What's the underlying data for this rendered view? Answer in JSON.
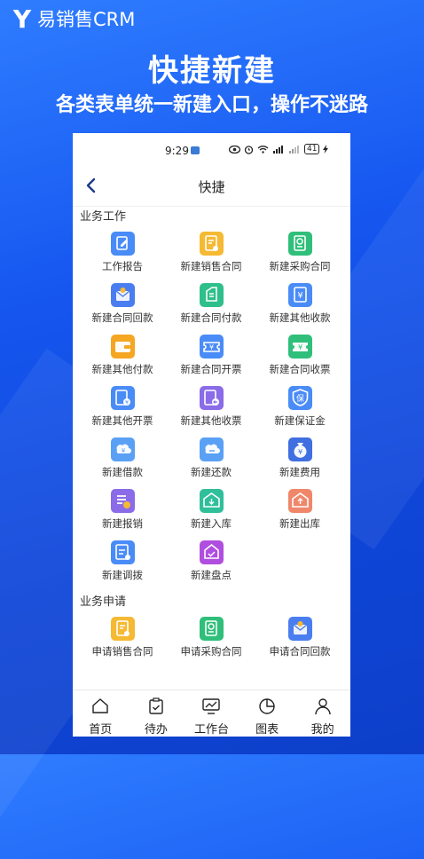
{
  "brand": {
    "logo_letter": "Y",
    "name": "易销售CRM"
  },
  "headline": "快捷新建",
  "subline": "各类表单统一新建入口，操作不迷路",
  "status_bar": {
    "time": "9:29",
    "battery": "41"
  },
  "nav": {
    "title": "快捷"
  },
  "sections": [
    {
      "title": "业务工作",
      "items": [
        {
          "label": "工作报告",
          "icon": "edit-doc-icon",
          "color": "#4a8cf7"
        },
        {
          "label": "新建销售合同",
          "icon": "contract-star-icon",
          "color": "#f5b933"
        },
        {
          "label": "新建采购合同",
          "icon": "contract-award-icon",
          "color": "#2fbf7a"
        },
        {
          "label": "新建合同回款",
          "icon": "envelope-money-icon",
          "color": "#4a7ef0"
        },
        {
          "label": "新建合同付款",
          "icon": "hand-doc-icon",
          "color": "#2fbf8a"
        },
        {
          "label": "新建其他收款",
          "icon": "yen-doc-icon",
          "color": "#4a8cf7"
        },
        {
          "label": "新建其他付款",
          "icon": "wallet-icon",
          "color": "#f5a623"
        },
        {
          "label": "新建合同开票",
          "icon": "ticket-icon",
          "color": "#4a8cf7"
        },
        {
          "label": "新建合同收票",
          "icon": "ticket-green-icon",
          "color": "#2fbf7a"
        },
        {
          "label": "新建其他开票",
          "icon": "invoice-yen-icon",
          "color": "#4a8cf7"
        },
        {
          "label": "新建其他收票",
          "icon": "invoice-in-icon",
          "color": "#8a6be8"
        },
        {
          "label": "新建保证金",
          "icon": "shield-bao-icon",
          "color": "#4a8cf7"
        },
        {
          "label": "新建借款",
          "icon": "cloud-hand-icon",
          "color": "#5aa0f5"
        },
        {
          "label": "新建还款",
          "icon": "cloud-hand-return-icon",
          "color": "#5aa0f5"
        },
        {
          "label": "新建费用",
          "icon": "money-bag-icon",
          "color": "#3f6fe0"
        },
        {
          "label": "新建报销",
          "icon": "list-yen-icon",
          "color": "#8a6be8"
        },
        {
          "label": "新建入库",
          "icon": "warehouse-in-icon",
          "color": "#2fbf9a"
        },
        {
          "label": "新建出库",
          "icon": "warehouse-out-icon",
          "color": "#f0876a"
        },
        {
          "label": "新建调拨",
          "icon": "transfer-doc-icon",
          "color": "#4a8cf7"
        },
        {
          "label": "新建盘点",
          "icon": "inventory-icon",
          "color": "#b04ee0"
        }
      ]
    },
    {
      "title": "业务申请",
      "items": [
        {
          "label": "申请销售合同",
          "icon": "contract-star-icon",
          "color": "#f5b933"
        },
        {
          "label": "申请采购合同",
          "icon": "contract-award-icon",
          "color": "#2fbf7a"
        },
        {
          "label": "申请合同回款",
          "icon": "envelope-money-icon",
          "color": "#4a7ef0"
        }
      ]
    }
  ],
  "tabs": [
    {
      "label": "首页",
      "icon": "home-icon"
    },
    {
      "label": "待办",
      "icon": "clipboard-check-icon"
    },
    {
      "label": "工作台",
      "icon": "monitor-chart-icon"
    },
    {
      "label": "图表",
      "icon": "pie-chart-icon"
    },
    {
      "label": "我的",
      "icon": "user-icon"
    }
  ]
}
